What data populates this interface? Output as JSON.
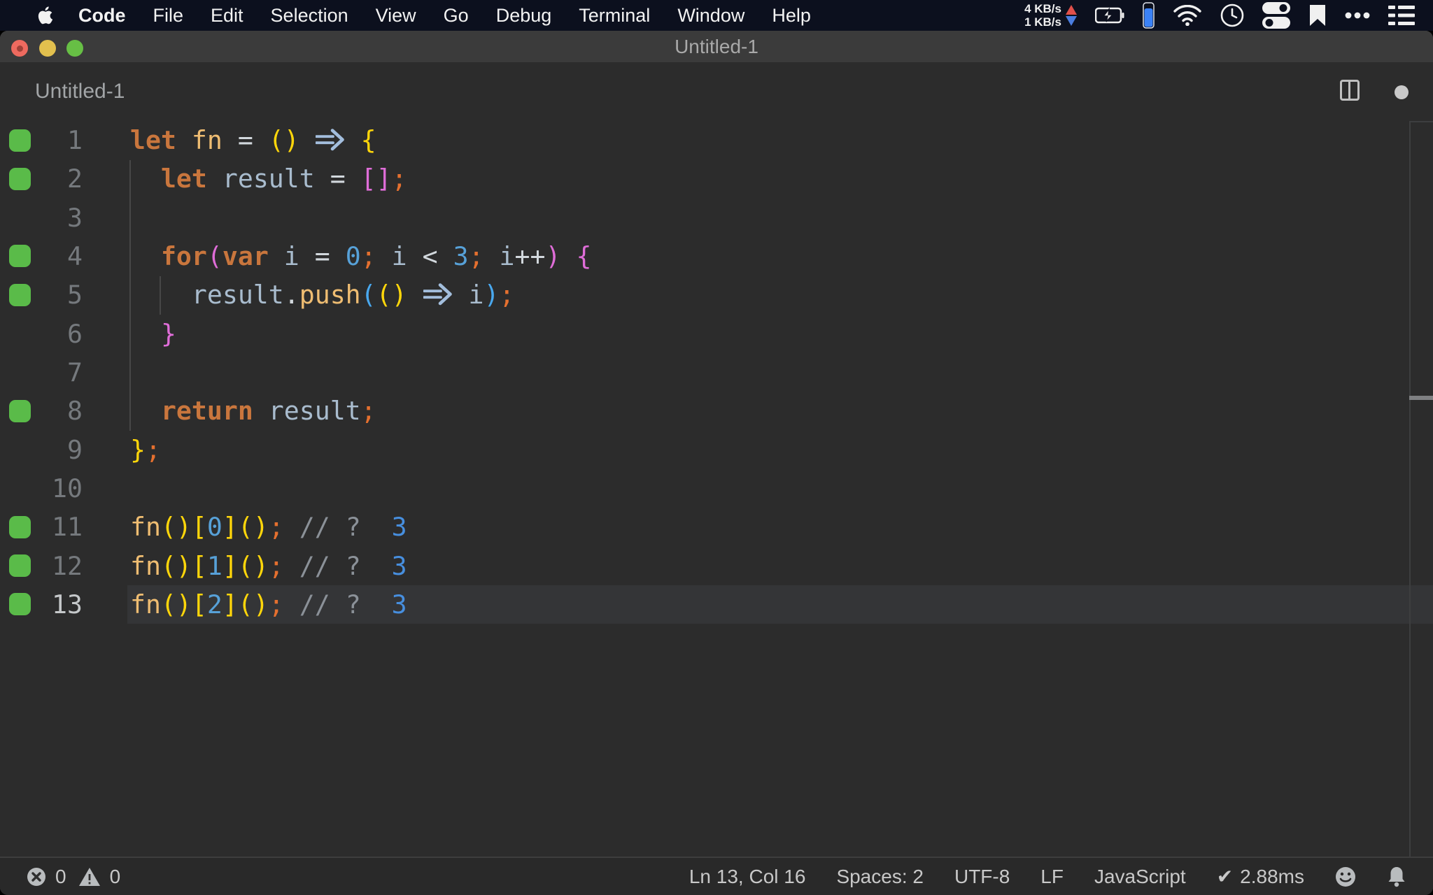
{
  "menu_bar": {
    "items": [
      "Code",
      "File",
      "Edit",
      "Selection",
      "View",
      "Go",
      "Debug",
      "Terminal",
      "Window",
      "Help"
    ],
    "net_up": "4 KB/s",
    "net_down": "1 KB/s"
  },
  "window": {
    "title": "Untitled-1"
  },
  "editor": {
    "tab_label": "Untitled-1",
    "language": "javascript",
    "lines": [
      {
        "n": 1,
        "changed": true,
        "active": false,
        "tokens": [
          [
            "kw",
            "let"
          ],
          [
            "pl",
            " "
          ],
          [
            "fn",
            "fn"
          ],
          [
            "op",
            " = "
          ],
          [
            "b1",
            "()"
          ],
          [
            "pl",
            " "
          ],
          [
            "ar",
            "⇒"
          ],
          [
            "pl",
            " "
          ],
          [
            "b1",
            "{"
          ]
        ]
      },
      {
        "n": 2,
        "changed": true,
        "active": false,
        "tokens": [
          [
            "pl",
            "  "
          ],
          [
            "kw",
            "let"
          ],
          [
            "pl",
            " "
          ],
          [
            "vr",
            "result"
          ],
          [
            "op",
            " = "
          ],
          [
            "b2",
            "[]"
          ],
          [
            "se",
            ";"
          ]
        ]
      },
      {
        "n": 3,
        "changed": false,
        "active": false,
        "tokens": []
      },
      {
        "n": 4,
        "changed": true,
        "active": false,
        "tokens": [
          [
            "pl",
            "  "
          ],
          [
            "kw",
            "for"
          ],
          [
            "b2",
            "("
          ],
          [
            "kw",
            "var"
          ],
          [
            "pl",
            " "
          ],
          [
            "vr",
            "i"
          ],
          [
            "op",
            " = "
          ],
          [
            "nu",
            "0"
          ],
          [
            "se",
            ";"
          ],
          [
            "pl",
            " "
          ],
          [
            "vr",
            "i"
          ],
          [
            "op",
            " < "
          ],
          [
            "nu",
            "3"
          ],
          [
            "se",
            ";"
          ],
          [
            "pl",
            " "
          ],
          [
            "vr",
            "i"
          ],
          [
            "op",
            "++"
          ],
          [
            "b2",
            ")"
          ],
          [
            "pl",
            " "
          ],
          [
            "b2",
            "{"
          ]
        ]
      },
      {
        "n": 5,
        "changed": true,
        "active": false,
        "tokens": [
          [
            "pl",
            "    "
          ],
          [
            "vr",
            "result"
          ],
          [
            "op",
            "."
          ],
          [
            "fn",
            "push"
          ],
          [
            "b3",
            "("
          ],
          [
            "b1",
            "()"
          ],
          [
            "pl",
            " "
          ],
          [
            "ar",
            "⇒"
          ],
          [
            "pl",
            " "
          ],
          [
            "vr",
            "i"
          ],
          [
            "b3",
            ")"
          ],
          [
            "se",
            ";"
          ]
        ]
      },
      {
        "n": 6,
        "changed": false,
        "active": false,
        "tokens": [
          [
            "pl",
            "  "
          ],
          [
            "b2",
            "}"
          ]
        ]
      },
      {
        "n": 7,
        "changed": false,
        "active": false,
        "tokens": []
      },
      {
        "n": 8,
        "changed": true,
        "active": false,
        "tokens": [
          [
            "pl",
            "  "
          ],
          [
            "kw",
            "return"
          ],
          [
            "pl",
            " "
          ],
          [
            "vr",
            "result"
          ],
          [
            "se",
            ";"
          ]
        ]
      },
      {
        "n": 9,
        "changed": false,
        "active": false,
        "tokens": [
          [
            "b1",
            "}"
          ],
          [
            "se",
            ";"
          ]
        ]
      },
      {
        "n": 10,
        "changed": false,
        "active": false,
        "tokens": []
      },
      {
        "n": 11,
        "changed": true,
        "active": false,
        "tokens": [
          [
            "fn",
            "fn"
          ],
          [
            "b1",
            "()["
          ],
          [
            "nu",
            "0"
          ],
          [
            "b1",
            "]()"
          ],
          [
            "se",
            ";"
          ],
          [
            "cm",
            " // ?"
          ],
          [
            "pl",
            "  "
          ],
          [
            "iv",
            "3"
          ]
        ]
      },
      {
        "n": 12,
        "changed": true,
        "active": false,
        "tokens": [
          [
            "fn",
            "fn"
          ],
          [
            "b1",
            "()["
          ],
          [
            "nu",
            "1"
          ],
          [
            "b1",
            "]()"
          ],
          [
            "se",
            ";"
          ],
          [
            "cm",
            " // ?"
          ],
          [
            "pl",
            "  "
          ],
          [
            "iv",
            "3"
          ]
        ]
      },
      {
        "n": 13,
        "changed": true,
        "active": true,
        "tokens": [
          [
            "fn",
            "fn"
          ],
          [
            "b1",
            "()["
          ],
          [
            "nu",
            "2"
          ],
          [
            "b1",
            "]()"
          ],
          [
            "se",
            ";"
          ],
          [
            "cm",
            " // ?"
          ],
          [
            "pl",
            "  "
          ],
          [
            "iv",
            "3"
          ]
        ]
      }
    ]
  },
  "status_bar": {
    "errors": "0",
    "warnings": "0",
    "cursor": "Ln 13, Col 16",
    "indentation": "Spaces: 2",
    "encoding": "UTF-8",
    "eol": "LF",
    "language": "JavaScript",
    "perf": "2.88ms"
  }
}
